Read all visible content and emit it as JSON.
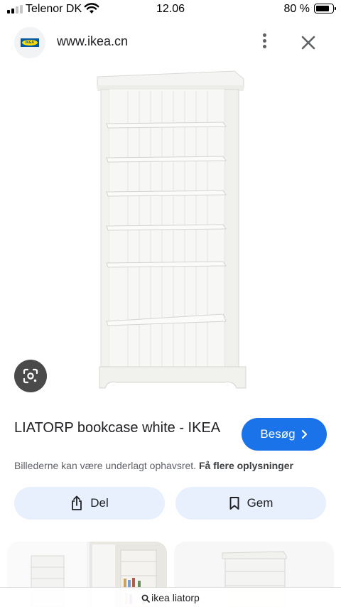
{
  "status_bar": {
    "carrier": "Telenor DK",
    "time": "12.06",
    "battery": "80 %"
  },
  "header": {
    "url": "www.ikea.cn",
    "favicon_text": "IKEA",
    "more_icon": "more-vert-icon",
    "close_icon": "close-icon"
  },
  "result": {
    "title": "LIATORP bookcase white - IKEA",
    "visit_label": "Besøg",
    "copyright_text": "Billederne kan være underlagt ophavsret.",
    "more_info_link": "Få flere oplysninger",
    "share_label": "Del",
    "save_label": "Gem"
  },
  "search": {
    "query": "ikea liatorp"
  },
  "colors": {
    "accent": "#1a73e8",
    "pill_bg": "#e8f0fe",
    "ikea_blue": "#0058a3",
    "ikea_yellow": "#ffdb00"
  }
}
